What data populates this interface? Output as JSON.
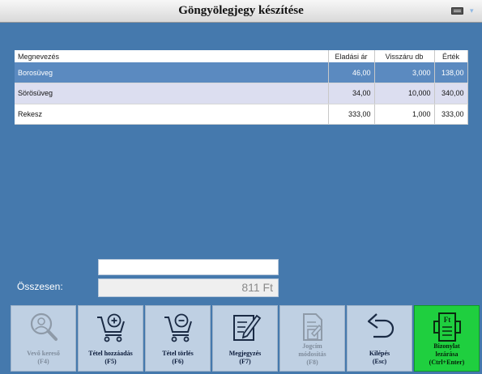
{
  "window": {
    "title": "Göngyölegjegy készítése"
  },
  "table": {
    "columns": [
      "Megnevezés",
      "Eladási ár",
      "Visszáru db",
      "Érték"
    ],
    "rows": [
      [
        "Borosüveg",
        "46,00",
        "3,000",
        "138,00"
      ],
      [
        "Sörösüveg",
        "34,00",
        "10,000",
        "340,00"
      ],
      [
        "Rekesz",
        "333,00",
        "1,000",
        "333,00"
      ]
    ]
  },
  "summary": {
    "input_value": "",
    "total_label": "Összesen:",
    "total_value": "811 Ft"
  },
  "toolbar": {
    "buttons": [
      {
        "line1": "Vevő kereső",
        "line2": "(F4)",
        "icon": "customer-search-icon",
        "enabled": false
      },
      {
        "line1": "Tétel hozzáadás",
        "line2": "(F5)",
        "icon": "cart-add-icon",
        "enabled": true
      },
      {
        "line1": "Tétel törlés",
        "line2": "(F6)",
        "icon": "cart-remove-icon",
        "enabled": true
      },
      {
        "line1": "Megjegyzés",
        "line2": "(F7)",
        "icon": "note-edit-icon",
        "enabled": true
      },
      {
        "line1": "Jogcím",
        "line2": "módosítás",
        "line3": "(F8)",
        "icon": "document-edit-icon",
        "enabled": false
      },
      {
        "line1": "Kilépés",
        "line2": "(Esc)",
        "icon": "back-arrow-icon",
        "enabled": true
      },
      {
        "line1": "Bizonylat",
        "line2": "lezárása",
        "line3": "(Ctrl+Enter)",
        "icon": "receipt-print-icon",
        "enabled": true,
        "icon_text": "Ft"
      }
    ]
  },
  "colors": {
    "background": "#4579ad",
    "selected_row": "#5b8ac0",
    "button": "#bfd0e3",
    "accent_green": "#1fcf3f"
  }
}
